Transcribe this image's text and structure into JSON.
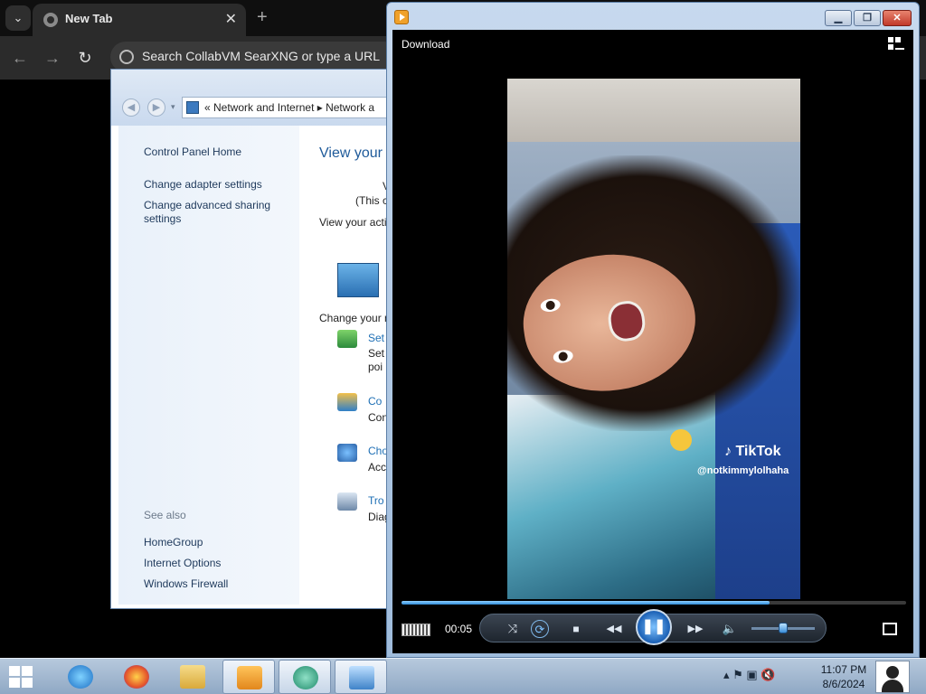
{
  "browser": {
    "tab_title": "New Tab",
    "tab_close": "✕",
    "new_tab": "+",
    "menu_glyph": "⌄",
    "back": "←",
    "forward": "→",
    "reload": "↻",
    "omnibox_text": "Search CollabVM SearXNG or type a URL"
  },
  "control_panel": {
    "nav_dropdown": "▾",
    "breadcrumb": "«  Network and Internet  ▸  Network a",
    "sidebar": {
      "home": "Control Panel Home",
      "links": [
        "Change adapter settings",
        "Change advanced sharing settings"
      ],
      "see_also_label": "See also",
      "see_also": [
        "HomeGroup",
        "Internet Options",
        "Windows Firewall"
      ]
    },
    "main": {
      "heading": "View your",
      "line_v": "V",
      "line_this": "(This c",
      "active_label": "View your acti",
      "change_label": "Change your n",
      "tasks": [
        {
          "title": "Set",
          "desc": "Set",
          "desc2": "poi"
        },
        {
          "title": "Co",
          "desc": "Con",
          "desc2": ""
        },
        {
          "title": "Cho",
          "desc": "Acc",
          "desc2": ""
        },
        {
          "title": "Tro",
          "desc": "Diag",
          "desc2": ""
        }
      ]
    }
  },
  "media_player": {
    "title_min": "▁",
    "title_max": "❐",
    "title_close": "✕",
    "download_label": "Download",
    "video": {
      "watermark": "♪ TikTok",
      "handle": "@notkimmylolhaha"
    },
    "progress": 0.73,
    "time": "00:05",
    "volume": 0.5,
    "controls": {
      "shuffle": "⤨",
      "repeat": "⟳",
      "stop": "■",
      "prev": "◀◀",
      "pause": "❚❚",
      "next": "▶▶",
      "volume_icon": "🔈"
    }
  },
  "taskbar": {
    "tray_icons": "▴  ⚑  ▣  🔇",
    "time": "11:07 PM",
    "date": "8/6/2024",
    "apps": [
      "internet-explorer",
      "firefox",
      "file-explorer",
      "windows-media-player",
      "media-center",
      "network-control-panel"
    ]
  },
  "colors": {
    "accent_blue": "#1e6fb5",
    "taskbar_top": "#b7c9dd",
    "seek_fill": "#2f8bd8"
  }
}
